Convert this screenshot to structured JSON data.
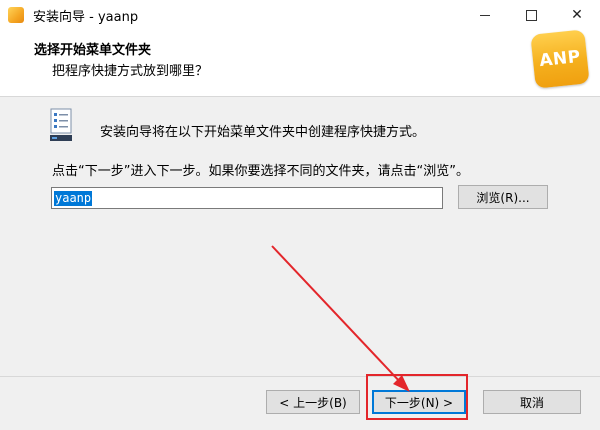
{
  "window": {
    "title": "安装向导 - yaanp",
    "controls": [
      "minimize",
      "maximize",
      "close"
    ]
  },
  "header": {
    "title": "选择开始菜单文件夹",
    "subtitle": "把程序快捷方式放到哪里？",
    "logo_text": "ANP"
  },
  "body": {
    "intro": "安装向导将在以下开始菜单文件夹中创建程序快捷方式。",
    "hint": "点击“下一步”进入下一步。如果你要选择不同的文件夹，请点击“浏览”。",
    "folder_value": "yaanp",
    "browse_label": "浏览(R)..."
  },
  "footer": {
    "back_label": "< 上一步(B)",
    "next_label": "下一步(N) >",
    "cancel_label": "取消"
  },
  "colors": {
    "accent": "#0078d7",
    "annotation": "#e3262b",
    "logo": "#f5b01e"
  }
}
